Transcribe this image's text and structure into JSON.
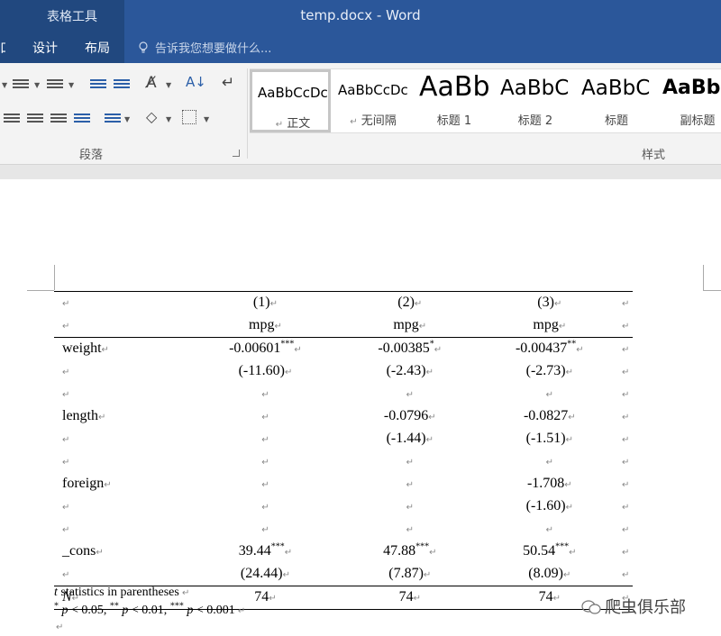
{
  "window": {
    "context_tab_title": "表格工具",
    "title": "temp.docx - Word"
  },
  "ribbon_tabs": {
    "left_fragment": "口",
    "design": "设计",
    "layout": "布局"
  },
  "tell_me": {
    "placeholder": "告诉我您想要做什么..."
  },
  "groups": {
    "paragraph": "段落",
    "styles": "样式"
  },
  "styles": [
    {
      "preview": "AaBbCcDc",
      "name": "正文",
      "selected": true
    },
    {
      "preview": "AaBbCcDc",
      "name": "无间隔",
      "selected": false
    },
    {
      "preview": "AaBb",
      "name": "标题 1",
      "selected": false
    },
    {
      "preview": "AaBbC",
      "name": "标题 2",
      "selected": false
    },
    {
      "preview": "AaBbC",
      "name": "标题",
      "selected": false
    },
    {
      "preview": "AaBb",
      "name": "副标题",
      "selected": false
    }
  ],
  "paragraph_mark": "↵",
  "table": {
    "header_models": [
      "(1)",
      "(2)",
      "(3)"
    ],
    "header_depvars": [
      "mpg",
      "mpg",
      "mpg"
    ],
    "rows": [
      {
        "label": "weight",
        "cells": [
          {
            "v": "-0.00601",
            "s": "***"
          },
          {
            "v": "-0.00385",
            "s": "*"
          },
          {
            "v": "-0.00437",
            "s": "**"
          }
        ]
      },
      {
        "label": "",
        "cells": [
          {
            "v": "(-11.60)",
            "s": ""
          },
          {
            "v": "(-2.43)",
            "s": ""
          },
          {
            "v": "(-2.73)",
            "s": ""
          }
        ]
      },
      {
        "label": "",
        "cells": [
          {
            "v": "",
            "s": ""
          },
          {
            "v": "",
            "s": ""
          },
          {
            "v": "",
            "s": ""
          }
        ]
      },
      {
        "label": "length",
        "cells": [
          {
            "v": "",
            "s": ""
          },
          {
            "v": "-0.0796",
            "s": ""
          },
          {
            "v": "-0.0827",
            "s": ""
          }
        ]
      },
      {
        "label": "",
        "cells": [
          {
            "v": "",
            "s": ""
          },
          {
            "v": "(-1.44)",
            "s": ""
          },
          {
            "v": "(-1.51)",
            "s": ""
          }
        ]
      },
      {
        "label": "",
        "cells": [
          {
            "v": "",
            "s": ""
          },
          {
            "v": "",
            "s": ""
          },
          {
            "v": "",
            "s": ""
          }
        ]
      },
      {
        "label": "foreign",
        "cells": [
          {
            "v": "",
            "s": ""
          },
          {
            "v": "",
            "s": ""
          },
          {
            "v": "-1.708",
            "s": ""
          }
        ]
      },
      {
        "label": "",
        "cells": [
          {
            "v": "",
            "s": ""
          },
          {
            "v": "",
            "s": ""
          },
          {
            "v": "(-1.60)",
            "s": ""
          }
        ]
      },
      {
        "label": "",
        "cells": [
          {
            "v": "",
            "s": ""
          },
          {
            "v": "",
            "s": ""
          },
          {
            "v": "",
            "s": ""
          }
        ]
      },
      {
        "label": "_cons",
        "cells": [
          {
            "v": "39.44",
            "s": "***"
          },
          {
            "v": "47.88",
            "s": "***"
          },
          {
            "v": "50.54",
            "s": "***"
          }
        ]
      },
      {
        "label": "",
        "cells": [
          {
            "v": "(24.44)",
            "s": ""
          },
          {
            "v": "(7.87)",
            "s": ""
          },
          {
            "v": "(8.09)",
            "s": ""
          }
        ]
      }
    ],
    "n_row": {
      "label": "N",
      "cells": [
        "74",
        "74",
        "74"
      ]
    }
  },
  "notes": {
    "line1_t": "t",
    "line1_rest": " statistics in parentheses",
    "line2_star1": "*",
    "line2_p1": "p",
    "line2_t1": " < 0.05, ",
    "line2_star2": "**",
    "line2_p2": "p",
    "line2_t2": " < 0.01, ",
    "line2_star3": "***",
    "line2_p3": "p",
    "line2_t3": " < 0.001"
  },
  "watermark": "爬虫俱乐部",
  "icons": [
    "bullets-icon",
    "numbering-icon",
    "multilevel-list-icon",
    "decrease-indent-icon",
    "increase-indent-icon",
    "chinese-layout-icon",
    "sort-icon",
    "show-marks-icon",
    "align-center-icon",
    "align-right-icon",
    "justify-icon",
    "distributed-icon",
    "line-spacing-icon",
    "shading-icon",
    "borders-icon",
    "lightbulb-icon",
    "wechat-icon"
  ]
}
